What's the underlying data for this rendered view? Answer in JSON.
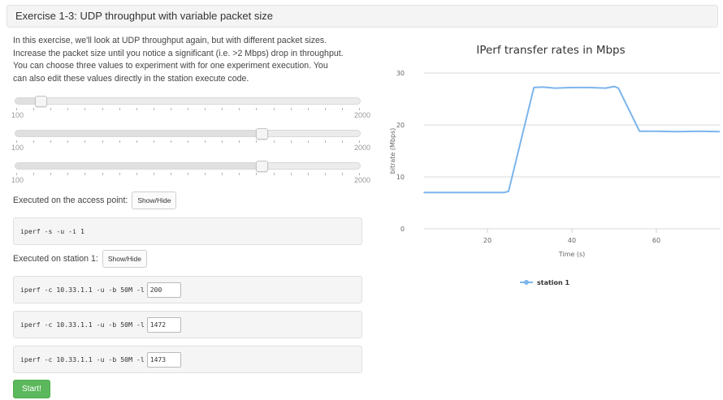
{
  "panel": {
    "title": "Exercise 1-3: UDP throughput with variable packet size"
  },
  "intro": {
    "lines": [
      "In this exercise, we'll look at UDP throughput again, but with different packet sizes.",
      "Increase the packet size until you notice a significant (i.e. >2 Mbps) drop in throughput.",
      "You can choose three values to experiment with for one experiment execution. You",
      "can also edit these values directly in the station execute code."
    ]
  },
  "sliders": [
    {
      "min_label": "100",
      "max_label": "2000",
      "min": 100,
      "max": 2000,
      "value": 200
    },
    {
      "min_label": "100",
      "max_label": "2000",
      "min": 100,
      "max": 2000,
      "value": 1472
    },
    {
      "min_label": "100",
      "max_label": "2000",
      "min": 100,
      "max": 2000,
      "value": 1473
    }
  ],
  "access_point": {
    "label": "Executed on the access point:",
    "toggle_label": "Show/Hide",
    "command": "iperf -s -u -i 1"
  },
  "station": {
    "label": "Executed on station 1:",
    "toggle_label": "Show/Hide",
    "commands": [
      {
        "prefix": "iperf -c 10.33.1.1 -u -b 50M -l",
        "value": "200"
      },
      {
        "prefix": "iperf -c 10.33.1.1 -u -b 50M -l",
        "value": "1472"
      },
      {
        "prefix": "iperf -c 10.33.1.1 -u -b 50M -l",
        "value": "1473"
      }
    ]
  },
  "start_button": {
    "label": "Start!"
  },
  "colors": {
    "accent_green": "#5cb85c",
    "series_blue": "#7cb5ec"
  },
  "chart_data": {
    "type": "line",
    "title": "IPerf transfer rates in Mbps",
    "xlabel": "Time (s)",
    "ylabel": "bitrate (Mbps)",
    "xlim": [
      5,
      75
    ],
    "ylim": [
      0,
      30
    ],
    "x_ticks": [
      20,
      40,
      60
    ],
    "y_ticks": [
      0,
      10,
      20,
      30
    ],
    "grid": true,
    "legend": "bottom-center",
    "series": [
      {
        "name": "station 1",
        "points": [
          [
            5,
            7.0
          ],
          [
            10,
            7.0
          ],
          [
            15,
            7.0
          ],
          [
            20,
            7.0
          ],
          [
            24,
            7.0
          ],
          [
            25,
            7.2
          ],
          [
            31,
            27.2
          ],
          [
            33,
            27.3
          ],
          [
            36,
            27.1
          ],
          [
            40,
            27.2
          ],
          [
            44,
            27.2
          ],
          [
            48,
            27.1
          ],
          [
            50,
            27.4
          ],
          [
            51,
            27.1
          ],
          [
            56,
            18.8
          ],
          [
            60,
            18.8
          ],
          [
            65,
            18.7
          ],
          [
            70,
            18.8
          ],
          [
            75,
            18.7
          ]
        ]
      }
    ]
  }
}
